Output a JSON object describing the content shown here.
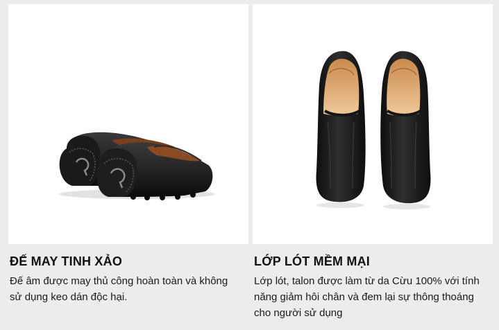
{
  "features": [
    {
      "image_alt": "Black leather loafers, rear view showing stitched heel counters",
      "title": "ĐẾ MAY TINH XẢO",
      "description": "Đế âm được may thủ công hoàn toàn và không sử dụng keo dán độc hại."
    },
    {
      "image_alt": "Pair of black leather loafers, top view showing tan leather lining",
      "title": "LỚP LÓT MỀM MẠI",
      "description": "Lớp lót, talon được làm từ da Cừu 100% với tính năng giảm hôi chân và đem lại sự thông thoáng cho người sử dụng"
    }
  ]
}
